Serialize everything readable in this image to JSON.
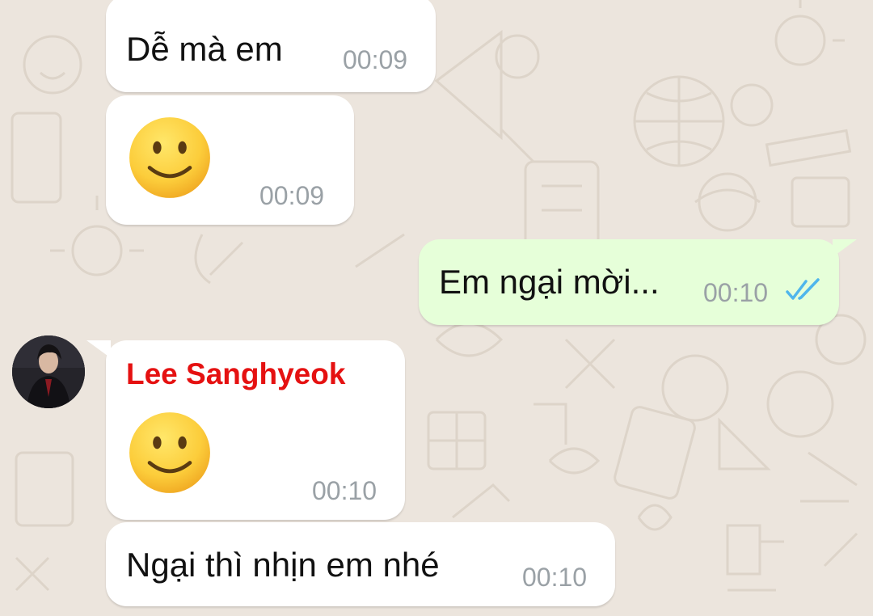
{
  "chat": {
    "messages": [
      {
        "text": "Dễ mà em",
        "time": "00:09",
        "direction": "incoming"
      },
      {
        "emoji": "slightly-smiling-face",
        "time": "00:09",
        "direction": "incoming"
      },
      {
        "text": "Em ngại mời...",
        "time": "00:10",
        "direction": "outgoing",
        "status": "read"
      },
      {
        "sender": "Lee Sanghyeok",
        "emoji": "slightly-smiling-face",
        "time": "00:10",
        "direction": "incoming"
      },
      {
        "text": "Ngại thì nhịn em nhé",
        "time": "00:10",
        "direction": "incoming"
      }
    ]
  },
  "colors": {
    "background": "#ece5dd",
    "incoming_bubble": "#ffffff",
    "outgoing_bubble": "#e6ffd9",
    "sender_name": "#e51111",
    "timestamp": "#9aa1a6",
    "read_ticks": "#4fb6ec"
  },
  "icons": {
    "emoji": "slightly-smiling-face-icon",
    "read_receipt": "double-check-icon",
    "avatar": "user-avatar"
  }
}
